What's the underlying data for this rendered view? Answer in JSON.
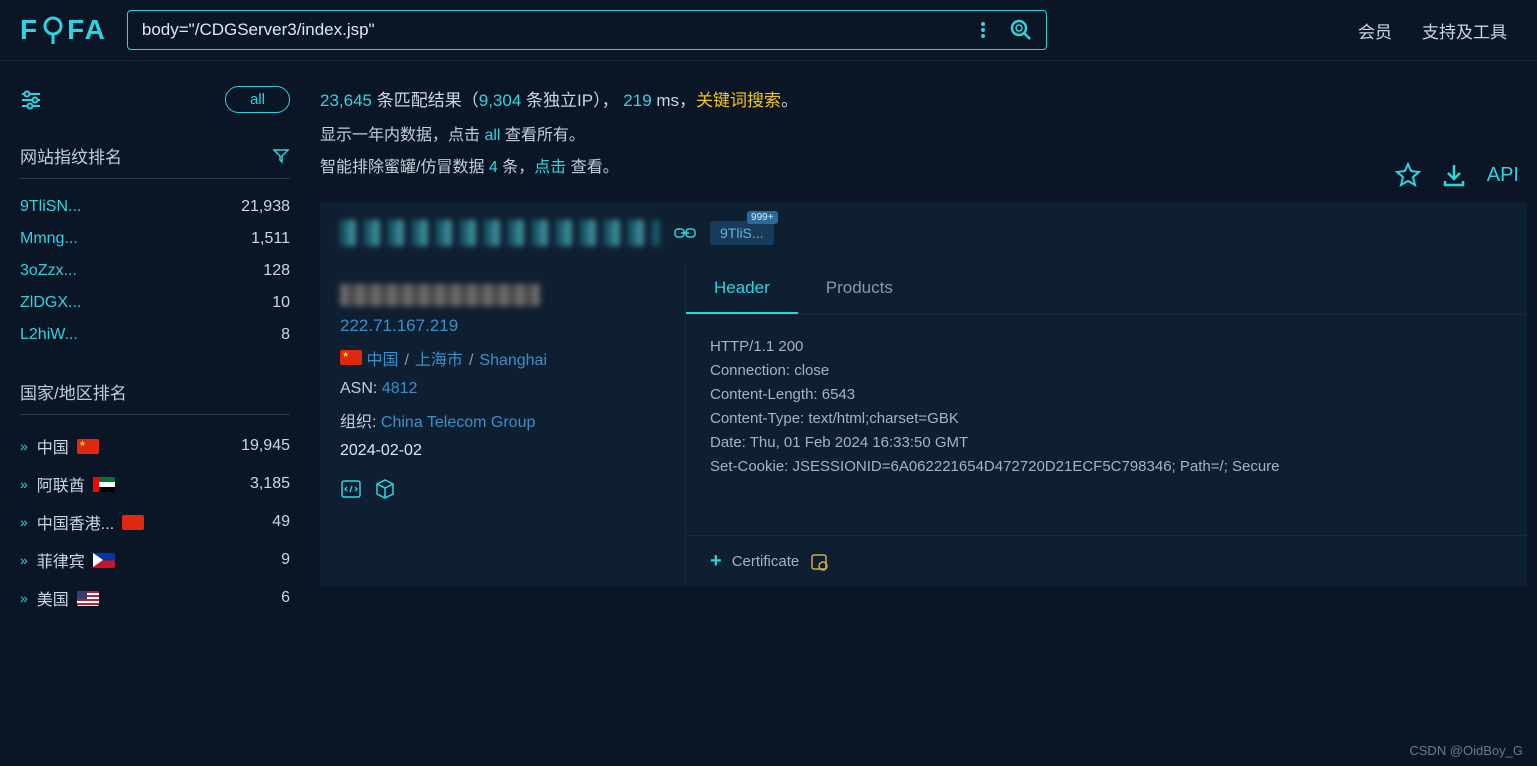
{
  "logo": "FOFA",
  "search": {
    "value": "body=\"/CDGServer3/index.jsp\""
  },
  "nav": {
    "member": "会员",
    "tools": "支持及工具"
  },
  "sidebar": {
    "all": "all",
    "fingerprint_title": "网站指纹排名",
    "fingerprints": [
      {
        "name": "9TliSN...",
        "count": "21,938"
      },
      {
        "name": "Mmng...",
        "count": "1,511"
      },
      {
        "name": "3oZzx...",
        "count": "128"
      },
      {
        "name": "ZlDGX...",
        "count": "10"
      },
      {
        "name": "L2hiW...",
        "count": "8"
      }
    ],
    "country_title": "国家/地区排名",
    "countries": [
      {
        "name": "中国",
        "flag": "cn",
        "count": "19,945"
      },
      {
        "name": "阿联酋",
        "flag": "ae",
        "count": "3,185"
      },
      {
        "name": "中国香港...",
        "flag": "hk",
        "count": "49"
      },
      {
        "name": "菲律宾",
        "flag": "ph",
        "count": "9"
      },
      {
        "name": "美国",
        "flag": "us",
        "count": "6"
      }
    ]
  },
  "stats": {
    "total": "23,645",
    "t1": " 条匹配结果（",
    "ips": "9,304",
    "t2": " 条独立IP），",
    "ms": " 219 ",
    "t3": "ms，",
    "keyword": "关键词搜索",
    "period": "。",
    "line2a": "显示一年内数据，点击 ",
    "line2b": "all",
    "line2c": " 查看所有。",
    "line3a": "智能排除蜜罐/仿冒数据 ",
    "line3b": "4",
    "line3c": " 条，",
    "line3d": "点击",
    "line3e": " 查看。"
  },
  "api_label": "API",
  "result": {
    "tag_text": "9TliS...",
    "tag_badge": "999+",
    "ip": "222.71.167.219",
    "country": "中国",
    "city": "上海市",
    "city_en": "Shanghai",
    "asn_label": "ASN: ",
    "asn": "4812",
    "org_label": "组织: ",
    "org": "China Telecom Group",
    "date": "2024-02-02",
    "tabs": {
      "header": "Header",
      "products": "Products"
    },
    "headers": "HTTP/1.1 200\nConnection: close\nContent-Length: 6543\nContent-Type: text/html;charset=GBK\nDate: Thu, 01 Feb 2024 16:33:50 GMT\nSet-Cookie: JSESSIONID=6A062221654D472720D21ECF5C798346; Path=/; Secure",
    "certificate": "Certificate"
  },
  "watermark": "CSDN @OidBoy_G"
}
